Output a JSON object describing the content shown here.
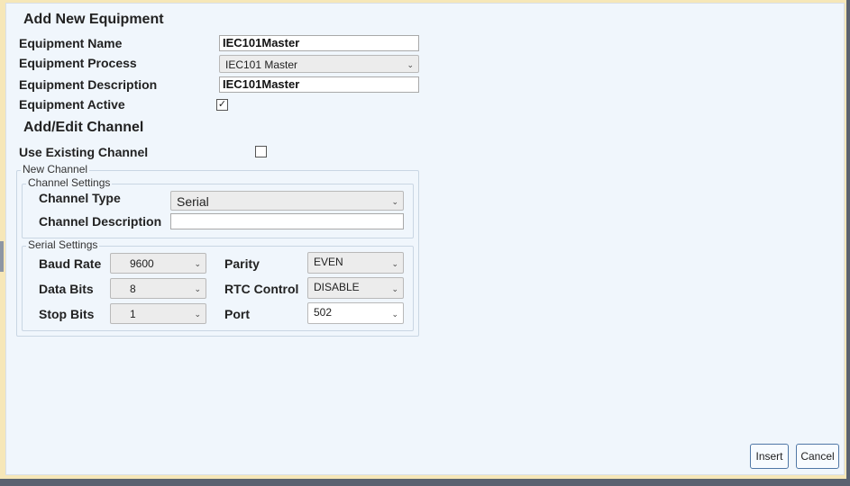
{
  "equipment": {
    "heading": "Add New Equipment",
    "name_label": "Equipment Name",
    "name_value": "IEC101Master",
    "process_label": "Equipment Process",
    "process_value": "IEC101 Master",
    "description_label": "Equipment Description",
    "description_value": "IEC101Master",
    "active_label": "Equipment Active",
    "active_checked": true
  },
  "channel": {
    "heading": "Add/Edit Channel",
    "use_existing_label": "Use Existing Channel",
    "use_existing_checked": false,
    "new_channel_legend": "New Channel",
    "settings_legend": "Channel Settings",
    "type_label": "Channel Type",
    "type_value": "Serial",
    "description_label": "Channel Description",
    "description_value": ""
  },
  "serial": {
    "legend": "Serial Settings",
    "baud_label": "Baud Rate",
    "baud_value": "9600",
    "data_bits_label": "Data Bits",
    "data_bits_value": "8",
    "stop_bits_label": "Stop Bits",
    "stop_bits_value": "1",
    "parity_label": "Parity",
    "parity_value": "EVEN",
    "rtc_label": "RTC Control",
    "rtc_value": "DISABLE",
    "port_label": "Port",
    "port_value": "502"
  },
  "buttons": {
    "insert": "Insert",
    "cancel": "Cancel"
  },
  "icons": {
    "dropdown": "chevron-down-icon",
    "check": "checkmark-icon"
  },
  "colors": {
    "dialog_bg": "#f0f6fc",
    "frame": "#f6e7b8",
    "button_border": "#4f77a6"
  }
}
